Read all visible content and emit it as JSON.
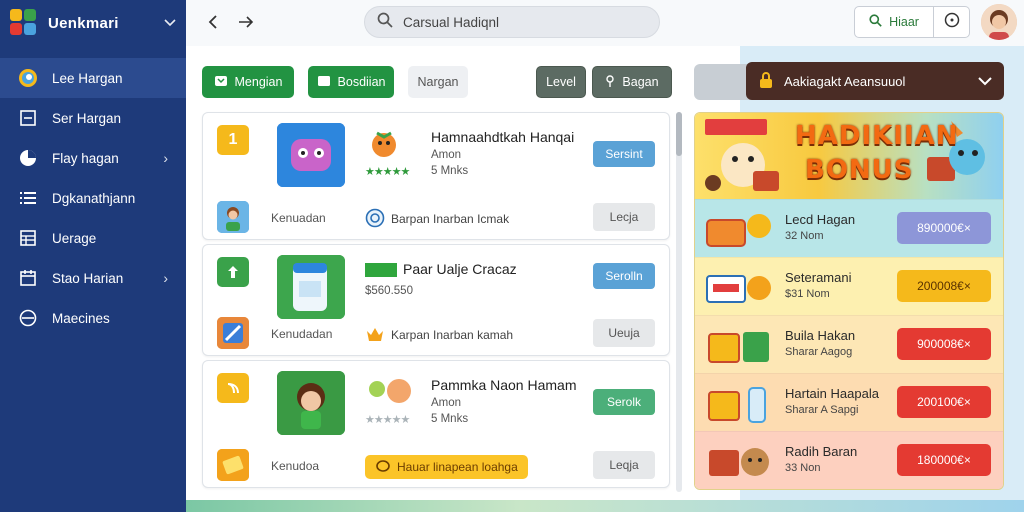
{
  "app": {
    "name": "Uenkmari"
  },
  "sidebar": {
    "items": [
      {
        "label": "Lee Hargan",
        "icon": "swirl-icon",
        "active": true,
        "arrow": false
      },
      {
        "label": "Ser Hargan",
        "icon": "square-icon",
        "active": false,
        "arrow": false
      },
      {
        "label": "Flay hagan",
        "icon": "pie-icon",
        "active": false,
        "arrow": true
      },
      {
        "label": "Dgkanathjann",
        "icon": "list-icon",
        "active": false,
        "arrow": false
      },
      {
        "label": "Uerage",
        "icon": "grid-icon",
        "active": false,
        "arrow": false
      },
      {
        "label": "Stao Harian",
        "icon": "calendar-icon",
        "active": false,
        "arrow": true
      },
      {
        "label": "Maecines",
        "icon": "circle-icon",
        "active": false,
        "arrow": false
      }
    ]
  },
  "topbar": {
    "search_value": "Carsual Hadiqnl",
    "search_button": "Hiaar"
  },
  "filters": {
    "left": [
      "Mengian",
      "Bosdiian",
      "Nargan"
    ],
    "right": [
      "Level",
      "Bagan"
    ]
  },
  "games": [
    {
      "rank": "1",
      "rank_color": "#f5b91b",
      "title": "Hamnaahdtkah Hanqai",
      "line2": "Amon",
      "line3": "5 Mnks",
      "stars": "★★★★★",
      "stars_style": "green",
      "top_button": "Sersint",
      "top_button_style": "blue",
      "row2_left": "Kenuadan",
      "row2_mid": "Barpan Inarban Icmak",
      "row2_mid_style": "plain",
      "bottom_button": "Lecja"
    },
    {
      "rank": "",
      "rank_color": "#3aa24a",
      "title": "Paar Ualje Cracaz",
      "line2": "$560.550",
      "line3": "",
      "stars": "",
      "stars_style": "green",
      "top_button": "Serolln",
      "top_button_style": "blue",
      "row2_left": "Kenudadan",
      "row2_mid": "Karpan Inarban kamah",
      "row2_mid_style": "plain",
      "bottom_button": "Ueuja"
    },
    {
      "rank": "",
      "rank_color": "#f5b91b",
      "title": "Pammka Naon Hamam",
      "line2": "Amon",
      "line3": "5 Mnks",
      "stars": "★★★★★",
      "stars_style": "grey",
      "top_button": "Serolk",
      "top_button_style": "green",
      "row2_left": "Kenudoa",
      "row2_mid": "Hauar linapean loahga",
      "row2_mid_style": "pill",
      "bottom_button": "Leqja"
    }
  ],
  "bonus_panel": {
    "dropdown": "Aakiagakt Aeansuuol",
    "hero_line1": "HADIKIIAN",
    "hero_line2": "BONUS",
    "rewards": [
      {
        "title": "Lecd Hagan",
        "sub": "32 Nom",
        "button": "890000€×",
        "bg": "#b8e6e8",
        "btn": "#8d96d8"
      },
      {
        "title": "Seteramani",
        "sub": "$31 Nom",
        "button": "200008€×",
        "bg": "#fdf0b0",
        "btn": "#f5b91b"
      },
      {
        "title": "Buila Hakan",
        "sub": "Sharar Aagog",
        "button": "900008€×",
        "bg": "#fde7b5",
        "btn": "#e43a32"
      },
      {
        "title": "Hartain Haapala",
        "sub": "Sharar A Sapgi",
        "button": "200100€×",
        "bg": "#fddcb1",
        "btn": "#e43a32"
      },
      {
        "title": "Radih Baran",
        "sub": "33 Non",
        "button": "180000€×",
        "bg": "#fdd0bf",
        "btn": "#e43a32"
      }
    ]
  }
}
